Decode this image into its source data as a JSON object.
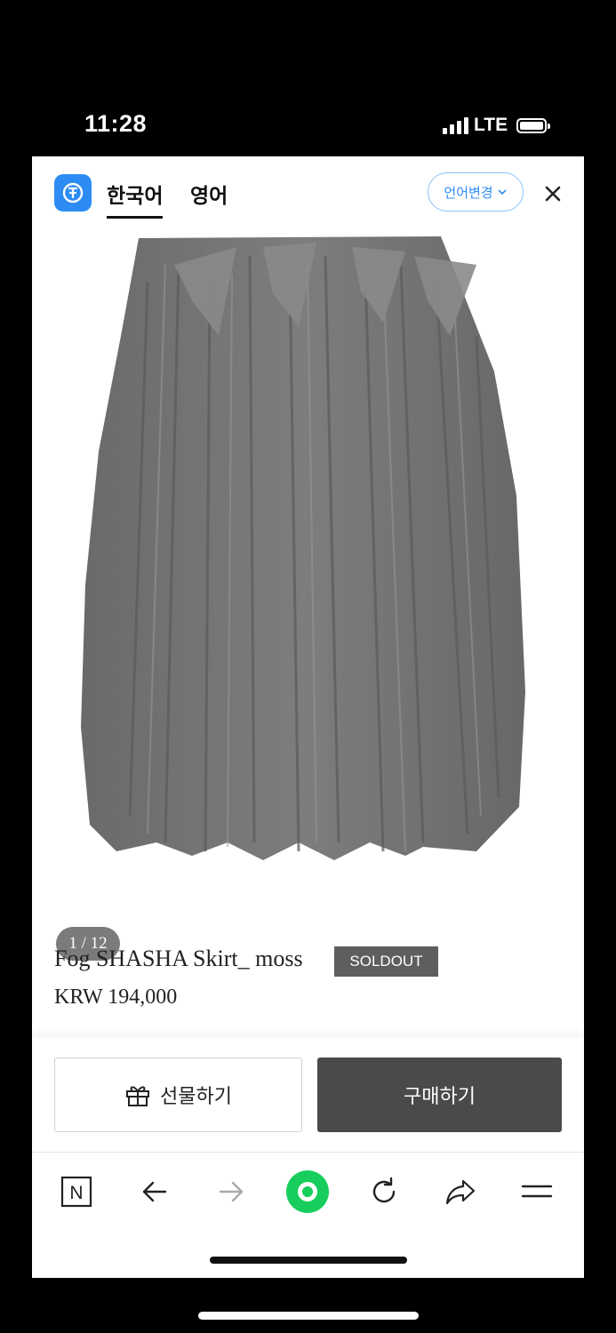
{
  "status": {
    "time": "11:28",
    "network": "LTE"
  },
  "header": {
    "tabs": [
      {
        "label": "한국어"
      },
      {
        "label": "영어"
      }
    ],
    "language_button": "언어변경"
  },
  "gallery": {
    "counter": "1 / 12"
  },
  "product": {
    "name": "Fog SHASHA Skirt_ moss",
    "badge": "SOLDOUT",
    "price": "KRW 194,000"
  },
  "actions": {
    "gift_label": "선물하기",
    "buy_label": "구매하기"
  },
  "browser_toolbar": {
    "items": [
      "n-icon",
      "back-arrow-icon",
      "forward-arrow-icon",
      "green-circle-icon",
      "refresh-icon",
      "share-icon",
      "menu-icon"
    ],
    "accent": "#17ce5c"
  },
  "colors": {
    "brand_blue": "#2c8cf4",
    "buy_button": "#4a4a4a",
    "badge": "#5e5e5e"
  }
}
